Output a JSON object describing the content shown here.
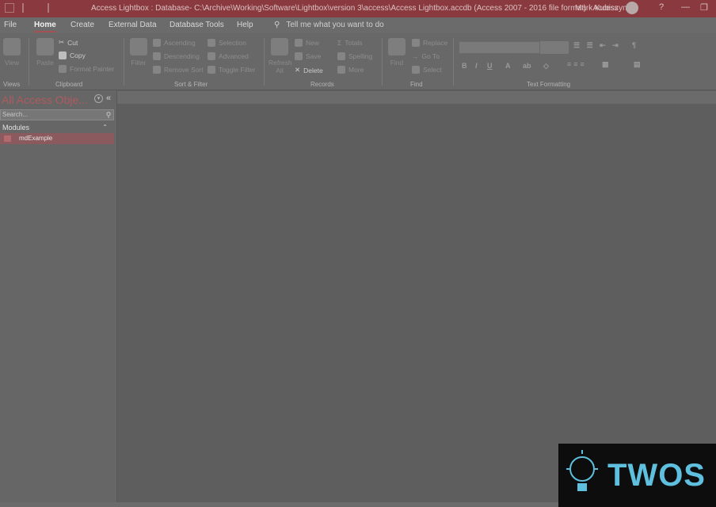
{
  "window": {
    "title": "Access Lightbox : Database- C:\\Archive\\Working\\Software\\Lightbox\\version 3\\access\\Access Lightbox.accdb (Access 2007 - 2016 file format)  -  Access",
    "user": "Mark Kubiszyn",
    "help_button": "?",
    "minimize_button": "—",
    "restore_button": "❐"
  },
  "tabs": [
    "File",
    "Home",
    "Create",
    "External Data",
    "Database Tools",
    "Help"
  ],
  "tell_me": "Tell me what you want to do",
  "ribbon": {
    "views": {
      "view_label": "View",
      "group_label": "Views"
    },
    "clipboard": {
      "paste": "Paste",
      "cut": "Cut",
      "copy": "Copy",
      "format_painter": "Format Painter",
      "group_label": "Clipboard"
    },
    "sort_filter": {
      "filter": "Filter",
      "ascending": "Ascending",
      "descending": "Descending",
      "remove_sort": "Remove Sort",
      "selection": "Selection",
      "advanced": "Advanced",
      "toggle_filter": "Toggle Filter",
      "group_label": "Sort & Filter"
    },
    "records": {
      "refresh": "Refresh",
      "refresh_all": "All",
      "new": "New",
      "save": "Save",
      "delete": "Delete",
      "totals": "Totals",
      "spelling": "Spelling",
      "more": "More",
      "group_label": "Records"
    },
    "find": {
      "find": "Find",
      "replace": "Replace",
      "goto": "Go To",
      "select": "Select",
      "group_label": "Find"
    },
    "text_formatting": {
      "bold": "B",
      "italic": "I",
      "underline": "U",
      "group_label": "Text Formatting"
    }
  },
  "nav": {
    "title": "All Access Obje...",
    "collapse": "«",
    "search_placeholder": "Search...",
    "section": "Modules",
    "items": [
      {
        "label": "mdExample"
      }
    ]
  },
  "logo": {
    "text": "TWOS"
  },
  "colors": {
    "accent": "#a45055",
    "titlebar": "#8a3a3e",
    "logo_text": "#5ec0de"
  }
}
